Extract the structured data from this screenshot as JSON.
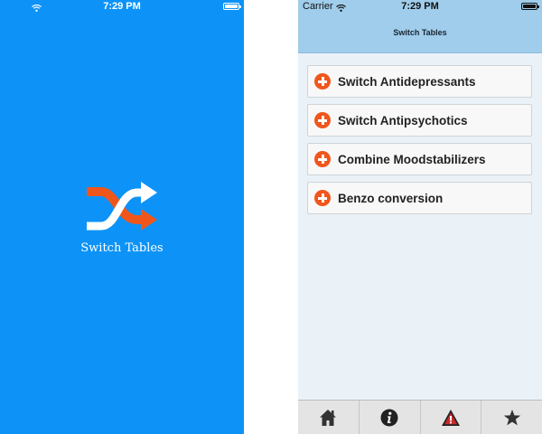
{
  "splash": {
    "status": {
      "carrier": "",
      "time": "7:29 PM"
    },
    "logo_icon": "shuffle-arrows-icon",
    "title": "Switch Tables",
    "colors": {
      "background": "#0d93f7",
      "arrow_orange": "#f0561c",
      "arrow_white": "#ffffff"
    }
  },
  "menu": {
    "status": {
      "carrier": "Carrier",
      "time": "7:29 PM"
    },
    "nav_title": "Switch Tables",
    "items": [
      {
        "label": "Switch Antidepressants",
        "icon": "plus-circle-icon"
      },
      {
        "label": "Switch Antipsychotics",
        "icon": "plus-circle-icon"
      },
      {
        "label": "Combine Moodstabilizers",
        "icon": "plus-circle-icon"
      },
      {
        "label": "Benzo conversion",
        "icon": "plus-circle-icon"
      }
    ],
    "tabs": [
      {
        "icon": "home-icon"
      },
      {
        "icon": "info-icon"
      },
      {
        "icon": "warning-icon"
      },
      {
        "icon": "star-icon"
      }
    ],
    "colors": {
      "navbar": "#9fcdeb",
      "background": "#eaf2f8",
      "accent": "#f0561c"
    }
  }
}
